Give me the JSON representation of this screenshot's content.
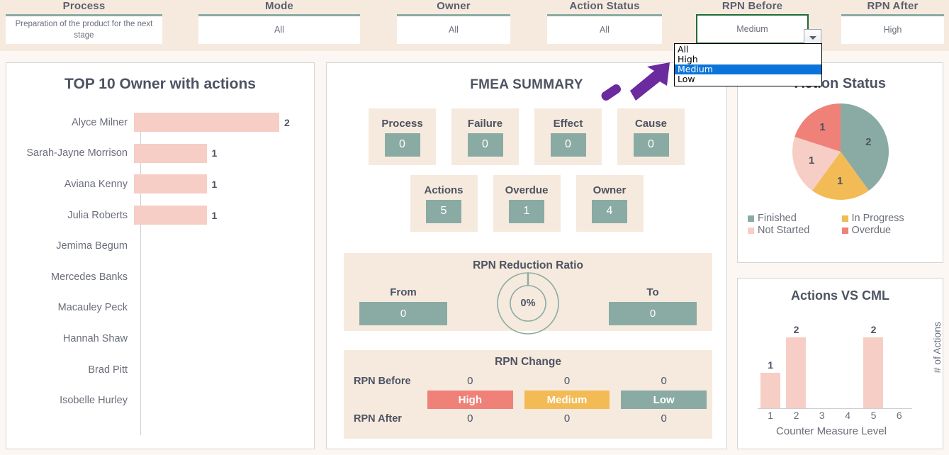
{
  "filters": [
    {
      "title": "Process",
      "value": "Preparation of the product for the next stage",
      "active": false
    },
    {
      "title": "Mode",
      "value": "All",
      "active": false
    },
    {
      "title": "Owner",
      "value": "All",
      "active": false
    },
    {
      "title": "Action Status",
      "value": "All",
      "active": false
    },
    {
      "title": "RPN Before",
      "value": "Medium",
      "active": true
    },
    {
      "title": "RPN After",
      "value": "High",
      "active": false
    }
  ],
  "dropdown": {
    "open": true,
    "owner": "RPN Before",
    "selected": "Medium",
    "options": [
      "All",
      "High",
      "Medium",
      "Low"
    ]
  },
  "top10": {
    "title": "TOP 10 Owner with actions",
    "rows": [
      {
        "name": "Alyce Milner",
        "value": 2
      },
      {
        "name": "Sarah-Jayne Morrison",
        "value": 1
      },
      {
        "name": "Aviana Kenny",
        "value": 1
      },
      {
        "name": "Julia Roberts",
        "value": 1
      },
      {
        "name": "Jemima Begum",
        "value": 0
      },
      {
        "name": "Mercedes Banks",
        "value": 0
      },
      {
        "name": "Macauley Peck",
        "value": 0
      },
      {
        "name": "Hannah Shaw",
        "value": 0
      },
      {
        "name": "Brad Pitt",
        "value": 0
      },
      {
        "name": "Isobelle Hurley",
        "value": 0
      }
    ]
  },
  "fmea": {
    "title": "FMEA SUMMARY",
    "kpis_row1": [
      {
        "label": "Process",
        "value": "0"
      },
      {
        "label": "Failure",
        "value": "0"
      },
      {
        "label": "Effect",
        "value": "0"
      },
      {
        "label": "Cause",
        "value": "0"
      }
    ],
    "kpis_row2": [
      {
        "label": "Actions",
        "value": "5"
      },
      {
        "label": "Overdue",
        "value": "1"
      },
      {
        "label": "Owner",
        "value": "4"
      }
    ],
    "ratio": {
      "title": "RPN Reduction Ratio",
      "from_label": "From",
      "from_value": "0",
      "to_label": "To",
      "to_value": "0",
      "percent_text": "0%",
      "percent": 0
    },
    "change": {
      "title": "RPN Change",
      "before_label": "RPN Before",
      "after_label": "RPN After",
      "bands": [
        {
          "label": "High",
          "color": "#ef8179",
          "before": "0",
          "after": "0"
        },
        {
          "label": "Medium",
          "color": "#f2bb55",
          "before": "0",
          "after": "0"
        },
        {
          "label": "Low",
          "color": "#8aaba3",
          "before": "0",
          "after": "0"
        }
      ]
    }
  },
  "chart_data": [
    {
      "type": "bar",
      "orientation": "horizontal",
      "title": "TOP 10 Owner with actions",
      "categories": [
        "Alyce Milner",
        "Sarah-Jayne Morrison",
        "Aviana Kenny",
        "Julia Roberts",
        "Jemima Begum",
        "Mercedes Banks",
        "Macauley Peck",
        "Hannah Shaw",
        "Brad Pitt",
        "Isobelle Hurley"
      ],
      "values": [
        2,
        1,
        1,
        1,
        0,
        0,
        0,
        0,
        0,
        0
      ],
      "xlabel": "",
      "ylabel": "",
      "xlim": [
        0,
        2
      ],
      "grid": false,
      "legend": "none",
      "color": "#f6cec5"
    },
    {
      "type": "pie",
      "title": "Action Status",
      "categories": [
        "Finished",
        "In Progress",
        "Not Started",
        "Overdue"
      ],
      "values": [
        2,
        1,
        1,
        1
      ],
      "colors": [
        "#8aaba3",
        "#f2bb55",
        "#f6cec5",
        "#ef8179"
      ],
      "legend": "bottom"
    },
    {
      "type": "bar",
      "title": "Actions VS CML",
      "categories": [
        "1",
        "2",
        "3",
        "4",
        "5",
        "6"
      ],
      "values": [
        1,
        2,
        0,
        0,
        2,
        0
      ],
      "xlabel": "Counter Measure Level",
      "ylabel": "# of Actions",
      "ylim": [
        0,
        2
      ],
      "grid": false,
      "legend": "none",
      "color": "#f6cec5"
    }
  ],
  "status": {
    "title": "Action Status",
    "slices": [
      {
        "label": "Finished",
        "value": 2,
        "color": "#8aaba3"
      },
      {
        "label": "In Progress",
        "value": 1,
        "color": "#f2bb55"
      },
      {
        "label": "Not Started",
        "value": 1,
        "color": "#f6cec5"
      },
      {
        "label": "Overdue",
        "value": 1,
        "color": "#ef8179"
      }
    ]
  },
  "cml": {
    "title": "Actions VS CML",
    "xlabel": "Counter Measure Level",
    "ylabel": "# of Actions",
    "levels": [
      {
        "tick": "1",
        "value": 1
      },
      {
        "tick": "2",
        "value": 2
      },
      {
        "tick": "3",
        "value": 0
      },
      {
        "tick": "4",
        "value": 0
      },
      {
        "tick": "5",
        "value": 2
      },
      {
        "tick": "6",
        "value": 0
      }
    ]
  }
}
